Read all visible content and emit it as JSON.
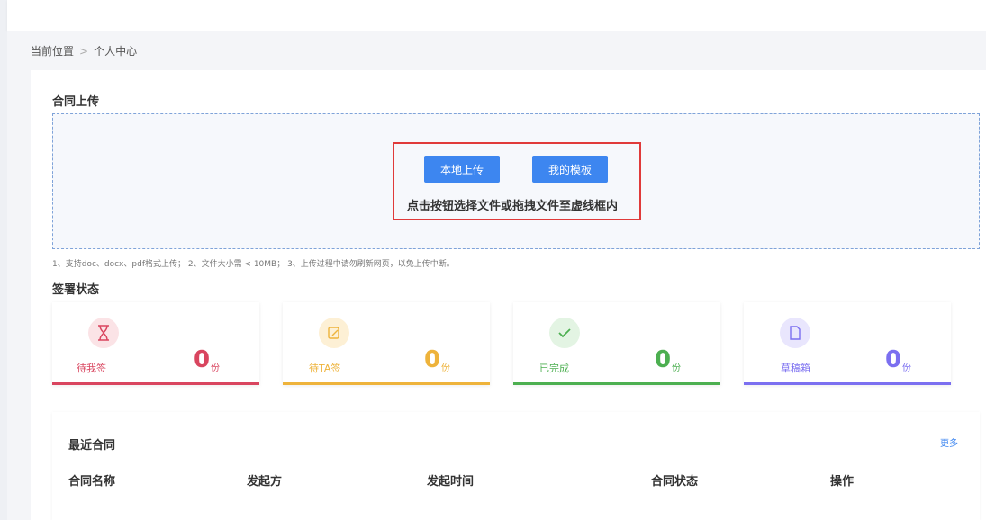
{
  "breadcrumb": {
    "label": "当前位置",
    "separator": ">",
    "current": "个人中心"
  },
  "upload": {
    "title": "合同上传",
    "local_button": "本地上传",
    "template_button": "我的模板",
    "hint": "点击按钮选择文件或拖拽文件至虚线框内",
    "notes": "1、支持doc、docx、pdf格式上传；  2、文件大小需 < 10MB；  3、上传过程中请勿刷新网页，以免上传中断。"
  },
  "status": {
    "title": "签署状态",
    "cards": [
      {
        "label": "待我签",
        "count": "0",
        "unit": "份",
        "icon": "hourglass-icon",
        "color": "#d9455f",
        "light": "#fbe3e6"
      },
      {
        "label": "待TA签",
        "count": "0",
        "unit": "份",
        "icon": "edit-note-icon",
        "color": "#eeb33b",
        "light": "#fdf0d5"
      },
      {
        "label": "已完成",
        "count": "0",
        "unit": "份",
        "icon": "check-icon",
        "color": "#4caf50",
        "light": "#e3f4e3"
      },
      {
        "label": "草稿箱",
        "count": "0",
        "unit": "份",
        "icon": "document-icon",
        "color": "#7b6ff0",
        "light": "#e9e6fd"
      }
    ]
  },
  "recent": {
    "title": "最近合同",
    "more": "更多",
    "columns": [
      "合同名称",
      "发起方",
      "发起时间",
      "合同状态",
      "操作"
    ]
  }
}
